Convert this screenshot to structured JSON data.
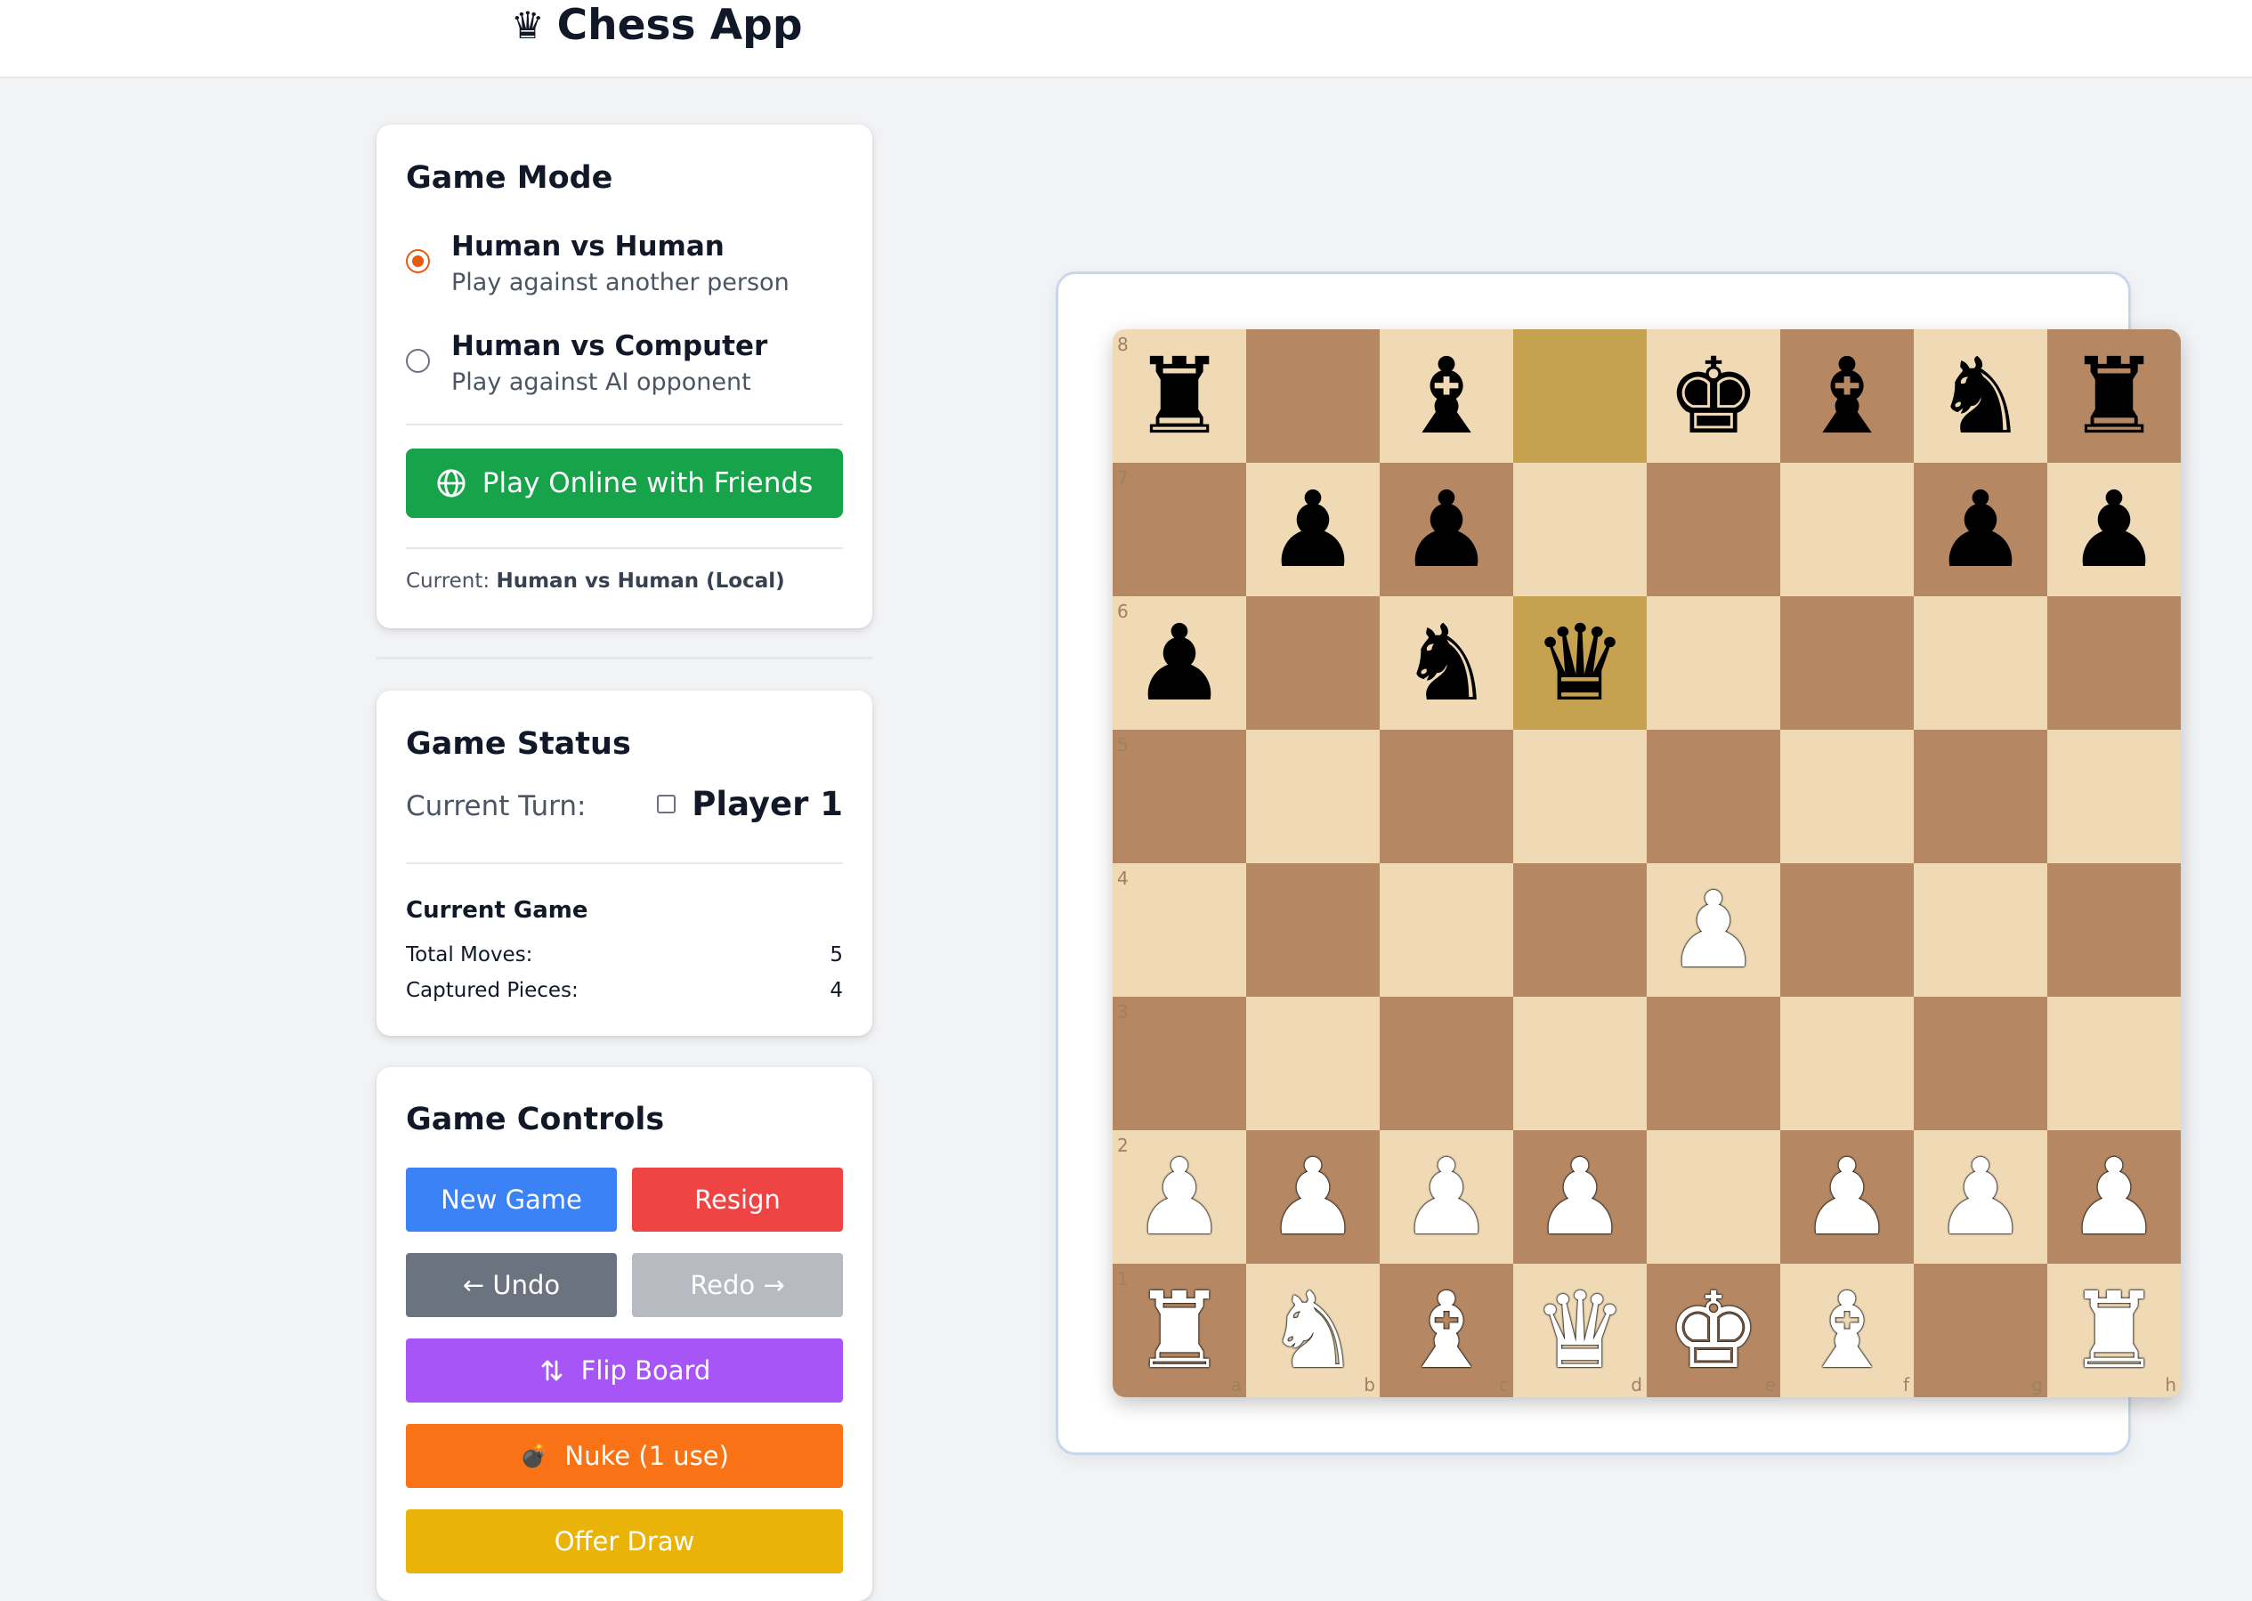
{
  "header": {
    "crown_glyph": "♛",
    "title": "Chess App"
  },
  "game_mode": {
    "title": "Game Mode",
    "options": [
      {
        "label": "Human vs Human",
        "description": "Play against another person",
        "selected": true
      },
      {
        "label": "Human vs Computer",
        "description": "Play against AI opponent",
        "selected": false
      }
    ],
    "online_button": {
      "label": "Play Online with Friends",
      "icon": "globe-icon",
      "color": "#16a34a"
    },
    "current_prefix": "Current:",
    "current_value": "Human vs Human (Local)"
  },
  "game_status": {
    "title": "Game Status",
    "turn_label": "Current Turn:",
    "turn_player": "Player 1",
    "current_game_title": "Current Game",
    "total_moves_label": "Total Moves:",
    "total_moves": "5",
    "captured_label": "Captured Pieces:",
    "captured": "4"
  },
  "game_controls": {
    "title": "Game Controls",
    "new_game": {
      "label": "New Game",
      "color": "#3b82f6"
    },
    "resign": {
      "label": "Resign",
      "color": "#ef4444"
    },
    "undo": {
      "label": "← Undo",
      "color": "#6b7280"
    },
    "redo": {
      "label": "Redo →",
      "color": "#b7bac1"
    },
    "flip": {
      "label": "Flip Board",
      "icon": "swap-arrows-icon",
      "color": "#a855f7"
    },
    "nuke": {
      "label": "Nuke (1 use)",
      "icon": "💣",
      "color": "#f97316"
    },
    "draw": {
      "label": "Offer Draw",
      "color": "#eab308"
    }
  },
  "board": {
    "light_color": "#f0d9b5",
    "dark_color": "#b58863",
    "highlight_color": "#c6a14f",
    "highlighted_squares": [
      "d8",
      "d6"
    ],
    "files": [
      "a",
      "b",
      "c",
      "d",
      "e",
      "f",
      "g",
      "h"
    ],
    "ranks": [
      "8",
      "7",
      "6",
      "5",
      "4",
      "3",
      "2",
      "1"
    ],
    "rows": [
      [
        "bR",
        "",
        "bB",
        "",
        "bK",
        "bB",
        "bN",
        "bR"
      ],
      [
        "",
        "bP",
        "bP",
        "",
        "",
        "",
        "bP",
        "bP"
      ],
      [
        "bP",
        "",
        "bN",
        "bQ",
        "",
        "",
        "",
        ""
      ],
      [
        "",
        "",
        "",
        "",
        "",
        "",
        "",
        ""
      ],
      [
        "",
        "",
        "",
        "",
        "wP",
        "",
        "",
        ""
      ],
      [
        "",
        "",
        "",
        "",
        "",
        "",
        "",
        ""
      ],
      [
        "wP",
        "wP",
        "wP",
        "wP",
        "",
        "wP",
        "wP",
        "wP"
      ],
      [
        "wR",
        "wN",
        "wB",
        "wQ",
        "wK",
        "wB",
        "",
        "wR"
      ]
    ]
  }
}
